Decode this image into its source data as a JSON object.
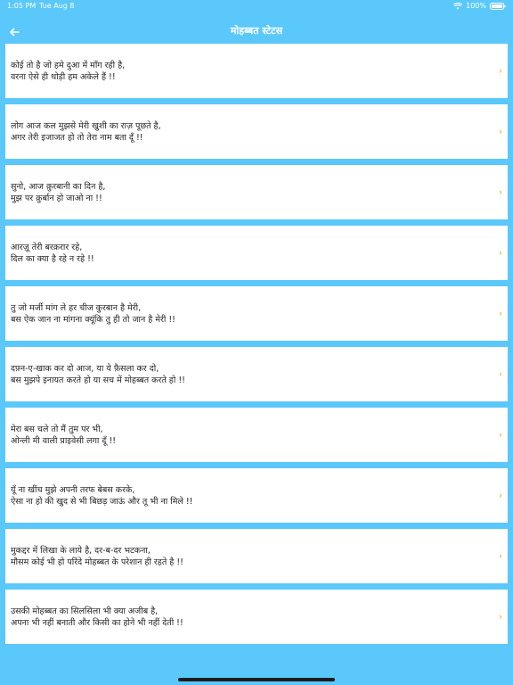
{
  "status_bar": {
    "time": "1:05 PM",
    "date": "Tue Aug 8",
    "battery": "100%"
  },
  "nav": {
    "back_icon": "back-arrow-icon",
    "title": "मोहब्बत स्टेटस"
  },
  "items": [
    {
      "line1": "कोई तो है जो हमे दुआ में माँग रही है,",
      "line2": "वरना ऐसे ही थोड़ी हम अकेले हैं !!"
    },
    {
      "line1": "लोग आज कल मुझसे मेरी खुशी का राज़ पूछते है,",
      "line2": "अगर तेरी इजाजत हो तो तेरा नाम बता दूँ !!"
    },
    {
      "line1": "सुनो, आज क़ुरबानी का दिन है,",
      "line2": "मुझ पर क़ुर्बान हो जाओ ना !!"
    },
    {
      "line1": "आरज़ू तेरी बरक़रार रहे,",
      "line2": "दिल का क्या है रहे न रहे !!"
    },
    {
      "line1": "तु जो मर्जी मांग ले हर चीज कुरबान है मेरी,",
      "line2": "बस ऐक जान ना मांगना क्यूंकि तु ही तो जान है मेरी !!"
    },
    {
      "line1": "दफ़्न-ए-खाक कर दो आज, या ये फ़ैसला कर दो,",
      "line2": "बस मुझपे इनायत करते हो या सच में मोहब्बत करते हो !!"
    },
    {
      "line1": "मेरा बस चले तो मैं तुम पर भी,",
      "line2": "ओन्ली मी वाली प्राइवेसी लगा दूँ !!"
    },
    {
      "line1": "यूँ ना खींच मुझे अपनी तरफ बेबस करके,",
      "line2": "ऐसा ना हो की खुद से भी बिछड़ जाऊं और तू भी ना मिले !!"
    },
    {
      "line1": "मुकद्दर में लिखा के लाये है, दर-ब-दर भटकना,",
      "line2": "मौसम कोई भी हो परिंदे मोहब्बत के परेशान ही रहते है !!"
    },
    {
      "line1": "उसकी मोहब्बत का सिलसिला भी क्या अजीब है,",
      "line2": "अपना भी नहीं बनाती और किसी का होने भी नहीं देती !!"
    }
  ],
  "colors": {
    "background": "#5AC8FA",
    "chevron": "#F5A623",
    "row_bg": "#FFFFFF"
  },
  "chevron_icon": "chevron-right-icon"
}
